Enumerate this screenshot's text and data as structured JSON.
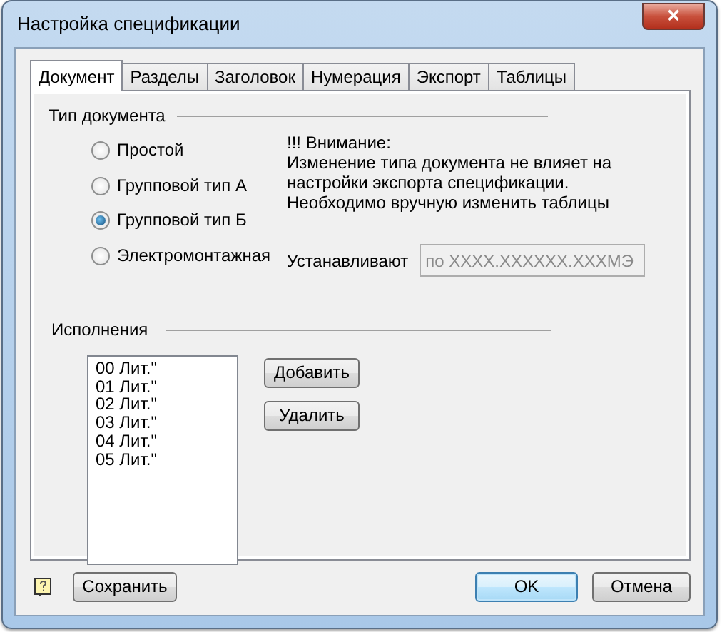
{
  "window": {
    "title": "Настройка спецификации",
    "close": "✕"
  },
  "tabs": [
    {
      "label": "Документ",
      "selected": true
    },
    {
      "label": "Разделы",
      "selected": false
    },
    {
      "label": "Заголовок",
      "selected": false
    },
    {
      "label": "Нумерация",
      "selected": false
    },
    {
      "label": "Экспорт",
      "selected": false
    },
    {
      "label": "Таблицы",
      "selected": false
    }
  ],
  "doc_type": {
    "label": "Тип документа",
    "options": [
      {
        "label": "Простой",
        "selected": false
      },
      {
        "label": "Групповой тип А",
        "selected": false
      },
      {
        "label": "Групповой тип Б",
        "selected": true
      },
      {
        "label": "Электромонтажная",
        "selected": false
      }
    ],
    "notice": [
      "!!! Внимание:",
      "Изменение типа документа не влияет на",
      "настройки экспорта спецификации.",
      "Необходимо вручную изменить таблицы"
    ],
    "installs": {
      "label": "Устанавливают",
      "value": "по XXXX.XXXXXX.XXXМЭ",
      "disabled": true
    }
  },
  "executions": {
    "label": "Исполнения",
    "items": [
      "00 Лит.\"",
      "01 Лит.\"",
      "02 Лит.\"",
      "03 Лит.\"",
      "04 Лит.\"",
      "05 Лит.\""
    ],
    "buttons": [
      "Добавить",
      "Удалить"
    ]
  },
  "footer": {
    "save": "Сохранить",
    "ok": "OK",
    "cancel": "Отмена"
  }
}
